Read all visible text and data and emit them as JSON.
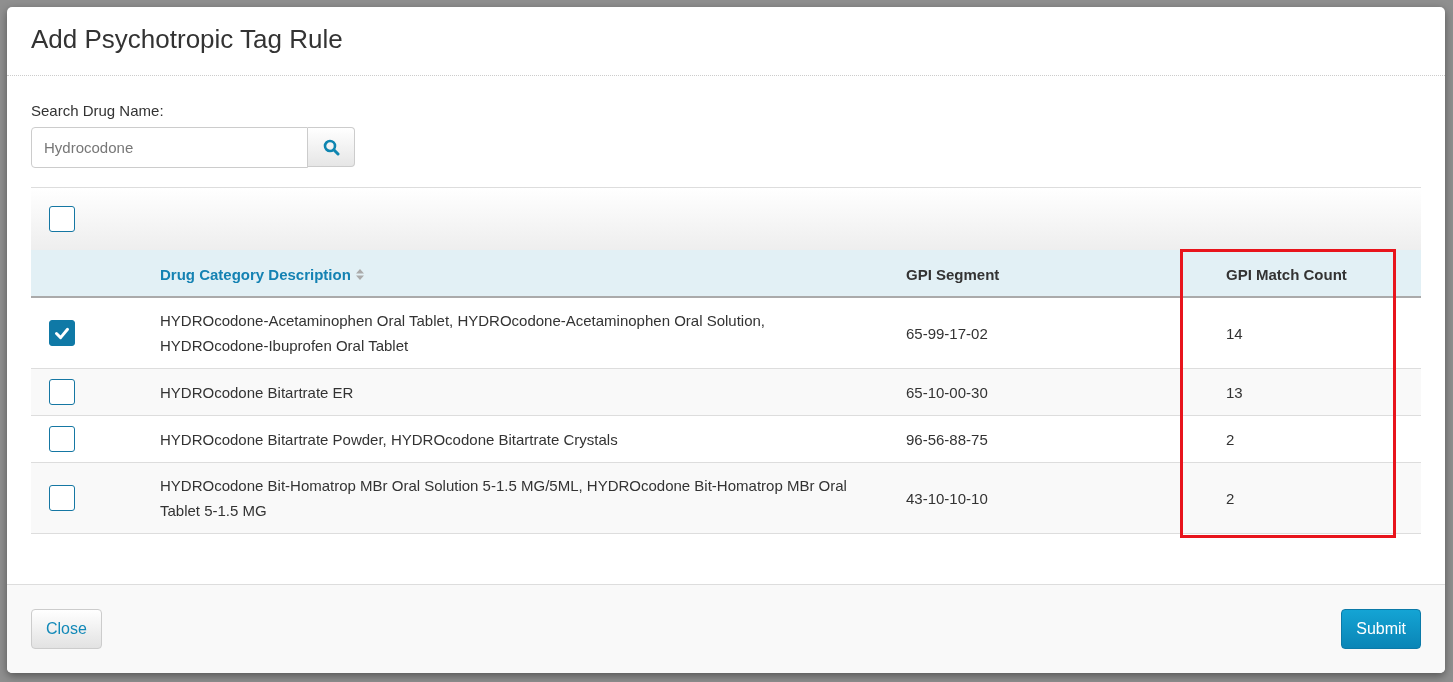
{
  "dialog": {
    "title": "Add Psychotropic Tag Rule"
  },
  "search": {
    "label": "Search Drug Name:",
    "placeholder": "Hydrocodone"
  },
  "table": {
    "select_all_checked": false,
    "columns": [
      {
        "label": "Drug Category Description",
        "sortable": true,
        "highlighted": false
      },
      {
        "label": "GPI Segment",
        "sortable": false,
        "highlighted": false
      },
      {
        "label": "GPI Match Count",
        "sortable": false,
        "highlighted": true
      }
    ],
    "rows": [
      {
        "selected": true,
        "cells": [
          "HYDROcodone-Acetaminophen Oral Tablet, HYDROcodone-Acetaminophen Oral Solution, HYDROcodone-Ibuprofen Oral Tablet",
          "65-99-17-02",
          "14"
        ]
      },
      {
        "selected": false,
        "cells": [
          "HYDROcodone Bitartrate ER",
          "65-10-00-30",
          "13"
        ]
      },
      {
        "selected": false,
        "cells": [
          "HYDROcodone Bitartrate Powder, HYDROcodone Bitartrate Crystals",
          "96-56-88-75",
          "2"
        ]
      },
      {
        "selected": false,
        "cells": [
          "HYDROcodone Bit-Homatrop MBr Oral Solution 5-1.5 MG/5ML, HYDROcodone Bit-Homatrop MBr Oral Tablet 5-1.5 MG",
          "43-10-10-10",
          "2"
        ]
      }
    ]
  },
  "footer": {
    "buttons": [
      {
        "label": "Close",
        "kind": "default"
      },
      {
        "label": "Submit",
        "kind": "primary"
      }
    ]
  }
}
